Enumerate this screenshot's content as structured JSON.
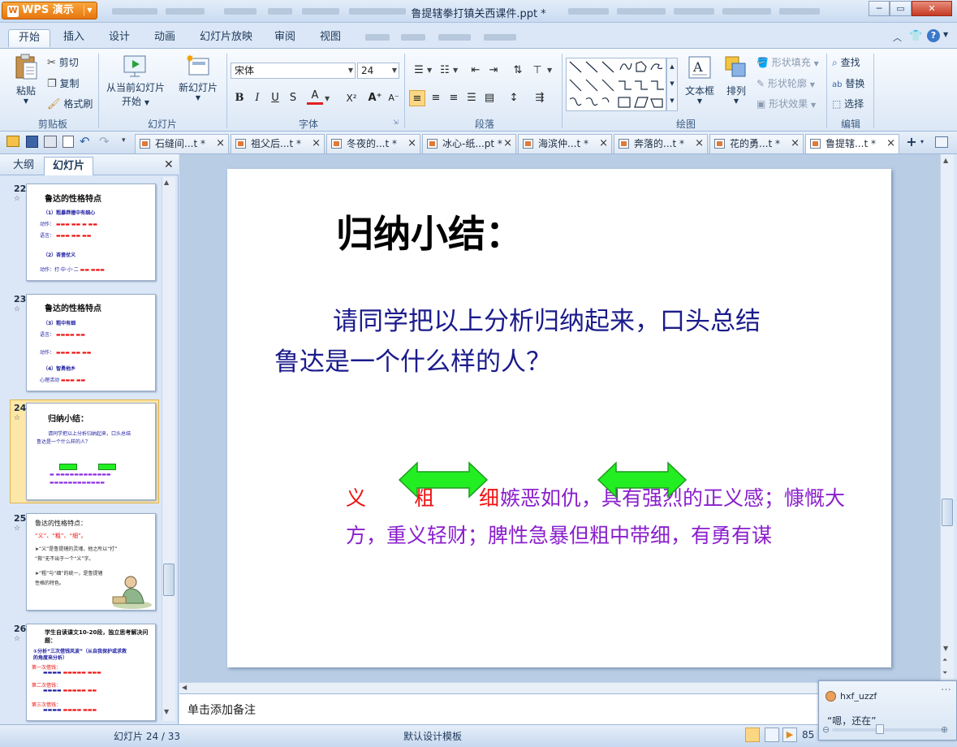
{
  "app": {
    "name": "WPS 演示",
    "doc_title": "鲁提辖拳打镇关西课件.ppt *"
  },
  "window_buttons": {
    "minimize": "─",
    "restore": "▭",
    "close": "✕"
  },
  "ribbon_tabs": [
    "开始",
    "插入",
    "设计",
    "动画",
    "幻灯片放映",
    "审阅",
    "视图"
  ],
  "clipboard": {
    "paste": "粘贴",
    "cut": "剪切",
    "copy": "复制",
    "format_painter": "格式刷",
    "group": "剪贴板"
  },
  "slides_group": {
    "from_current": "从当前幻灯片",
    "start": "开始",
    "new_slide": "新幻灯片",
    "group": "幻灯片"
  },
  "font": {
    "name": "宋体",
    "size": "24",
    "bold": "B",
    "italic": "I",
    "underline": "U",
    "strike": "S",
    "color": "A",
    "super": "X²",
    "grow": "A⁺",
    "shrink": "A⁻",
    "group": "字体"
  },
  "paragraph": {
    "group": "段落"
  },
  "drawing": {
    "text_box": "文本框",
    "arrange": "排列",
    "shape_fill": "形状填充",
    "shape_outline": "形状轮廓",
    "shape_effect": "形状效果",
    "group": "绘图"
  },
  "editing": {
    "find": "查找",
    "replace": "替换",
    "select": "选择",
    "group": "编辑"
  },
  "doc_tabs": [
    "石缝间...t *",
    "祖父后...t *",
    "冬夜的...t *",
    "冰心-纸...pt *",
    "海滨仲...t *",
    "奔落的...t *",
    "花的勇...t *",
    "鲁提辖...t *"
  ],
  "left_panel": {
    "tab_outline": "大纲",
    "tab_slides": "幻灯片"
  },
  "thumbnails": [
    {
      "num": "22",
      "title": "鲁达的性格特点",
      "lines": [
        "（1）粗暴莽撞中有细心",
        "动作：",
        "语言：",
        "（2）吝啬仗义",
        "动作：打·中·小·二"
      ]
    },
    {
      "num": "23",
      "title": "鲁达的性格特点",
      "lines": [
        "（3）粗中有细",
        "语言：",
        "动作：",
        "（4）智勇他乡",
        "心理活动"
      ]
    },
    {
      "num": "24",
      "title": "归纳小结：",
      "lines": [
        "请同学把以上分析归纳起来，口头总结",
        "鲁达是一个什么样的人？"
      ]
    },
    {
      "num": "25",
      "title": "鲁达的性格特点：",
      "lines": [
        "“义”、“粗”、“细”。",
        "➤“义”是鲁提辖的灵魂，他之所以“打”",
        "“救”无不出于一个“义”字。",
        "➤“粗”与“细”的统一，是鲁提辖",
        "性格的特色。"
      ]
    },
    {
      "num": "26",
      "title": "学生自读课文10-20段，独立思考解决问题：",
      "lines": [
        "①分析“三次借钱风波”（从自我保护或求救",
        "的角度来分析）",
        "第一次借钱：",
        "第二次借钱：",
        "第三次借钱："
      ]
    }
  ],
  "slide": {
    "title": "归纳小结：",
    "question_line1": "请同学把以上分析归纳起来，口头总结",
    "question_line2": "鲁达是一个什么样的人？",
    "word_yi": "义",
    "word_cu": "粗",
    "word_xi": "细",
    "summary_line1": "嫉恶如仇，具有强烈的正义感；慷慨大",
    "summary_line2": "方，重义轻财；脾性急暴但粗中带细，有勇有谋",
    "arrow_color": "#22ee22"
  },
  "notes_placeholder": "单击添加备注",
  "status": {
    "slide_info": "幻灯片 24 / 33",
    "template": "默认设计模板",
    "zoom": "85"
  },
  "chat": {
    "user": "hxf_uzzf",
    "message": "“嗯，还在”"
  }
}
